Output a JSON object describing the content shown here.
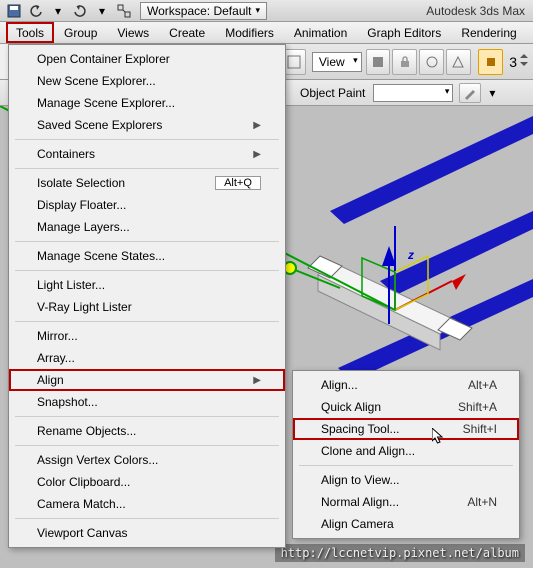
{
  "titlebar": {
    "workspace_label": "Workspace: Default",
    "app_title": "Autodesk 3ds Max"
  },
  "menubar": {
    "tools": "Tools",
    "group": "Group",
    "views": "Views",
    "create": "Create",
    "modifiers": "Modifiers",
    "animation": "Animation",
    "graph_editors": "Graph Editors",
    "rendering": "Rendering"
  },
  "toolbar": {
    "view_label": "View",
    "object_paint": "Object Paint",
    "number": "3"
  },
  "tools_menu": {
    "open_container_explorer": "Open Container Explorer",
    "new_scene_explorer": "New Scene Explorer...",
    "manage_scene_explorer": "Manage Scene Explorer...",
    "saved_scene_explorers": "Saved Scene Explorers",
    "containers": "Containers",
    "isolate_selection": "Isolate Selection",
    "isolate_shortcut": "Alt+Q",
    "display_floater": "Display Floater...",
    "manage_layers": "Manage Layers...",
    "manage_scene_states": "Manage Scene States...",
    "light_lister": "Light Lister...",
    "vray_light_lister": "V-Ray Light Lister",
    "mirror": "Mirror...",
    "array": "Array...",
    "align": "Align",
    "snapshot": "Snapshot...",
    "rename_objects": "Rename Objects...",
    "assign_vertex_colors": "Assign Vertex Colors...",
    "color_clipboard": "Color Clipboard...",
    "camera_match": "Camera Match...",
    "viewport_canvas": "Viewport Canvas"
  },
  "align_submenu": {
    "align": "Align...",
    "align_sc": "Alt+A",
    "quick_align": "Quick Align",
    "quick_align_sc": "Shift+A",
    "spacing_tool": "Spacing Tool...",
    "spacing_tool_sc": "Shift+I",
    "clone_and_align": "Clone and Align...",
    "align_to_view": "Align to View...",
    "normal_align": "Normal Align...",
    "normal_align_sc": "Alt+N",
    "align_camera": "Align Camera"
  },
  "axis": {
    "z": "z"
  },
  "watermark": "http://lccnetvip.pixnet.net/album"
}
